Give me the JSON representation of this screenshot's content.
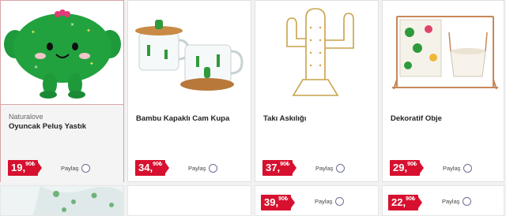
{
  "products": [
    {
      "brand": "Naturalove",
      "title": "Oyuncak Peluş Yastık",
      "price_int": "19,",
      "price_dec": "90",
      "currency": "₺",
      "share_label": "Paylaş",
      "image_icon": "cactus-plush-icon"
    },
    {
      "brand": "",
      "title": "Bambu Kapaklı Cam Kupa",
      "price_int": "34,",
      "price_dec": "90",
      "currency": "₺",
      "share_label": "Paylaş",
      "image_icon": "glass-mugs-icon"
    },
    {
      "brand": "",
      "title": "Takı Askılığı",
      "price_int": "37,",
      "price_dec": "90",
      "currency": "₺",
      "share_label": "Paylaş",
      "image_icon": "jewelry-stand-icon"
    },
    {
      "brand": "",
      "title": "Dekoratif Obje",
      "price_int": "29,",
      "price_dec": "90",
      "currency": "₺",
      "share_label": "Paylaş",
      "image_icon": "decor-frame-icon"
    }
  ],
  "bottom_row": [
    {
      "image_icon": "fabric-pattern-icon"
    },
    {},
    {
      "price_int": "39,",
      "price_dec": "90",
      "currency": "₺",
      "share_label": "Paylaş"
    },
    {
      "price_int": "22,",
      "price_dec": "90",
      "currency": "₺",
      "share_label": "Paylaş"
    }
  ],
  "colors": {
    "price_red": "#d7102f",
    "selected_border": "#d9a3a8",
    "cactus_green": "#1f9a3a"
  }
}
